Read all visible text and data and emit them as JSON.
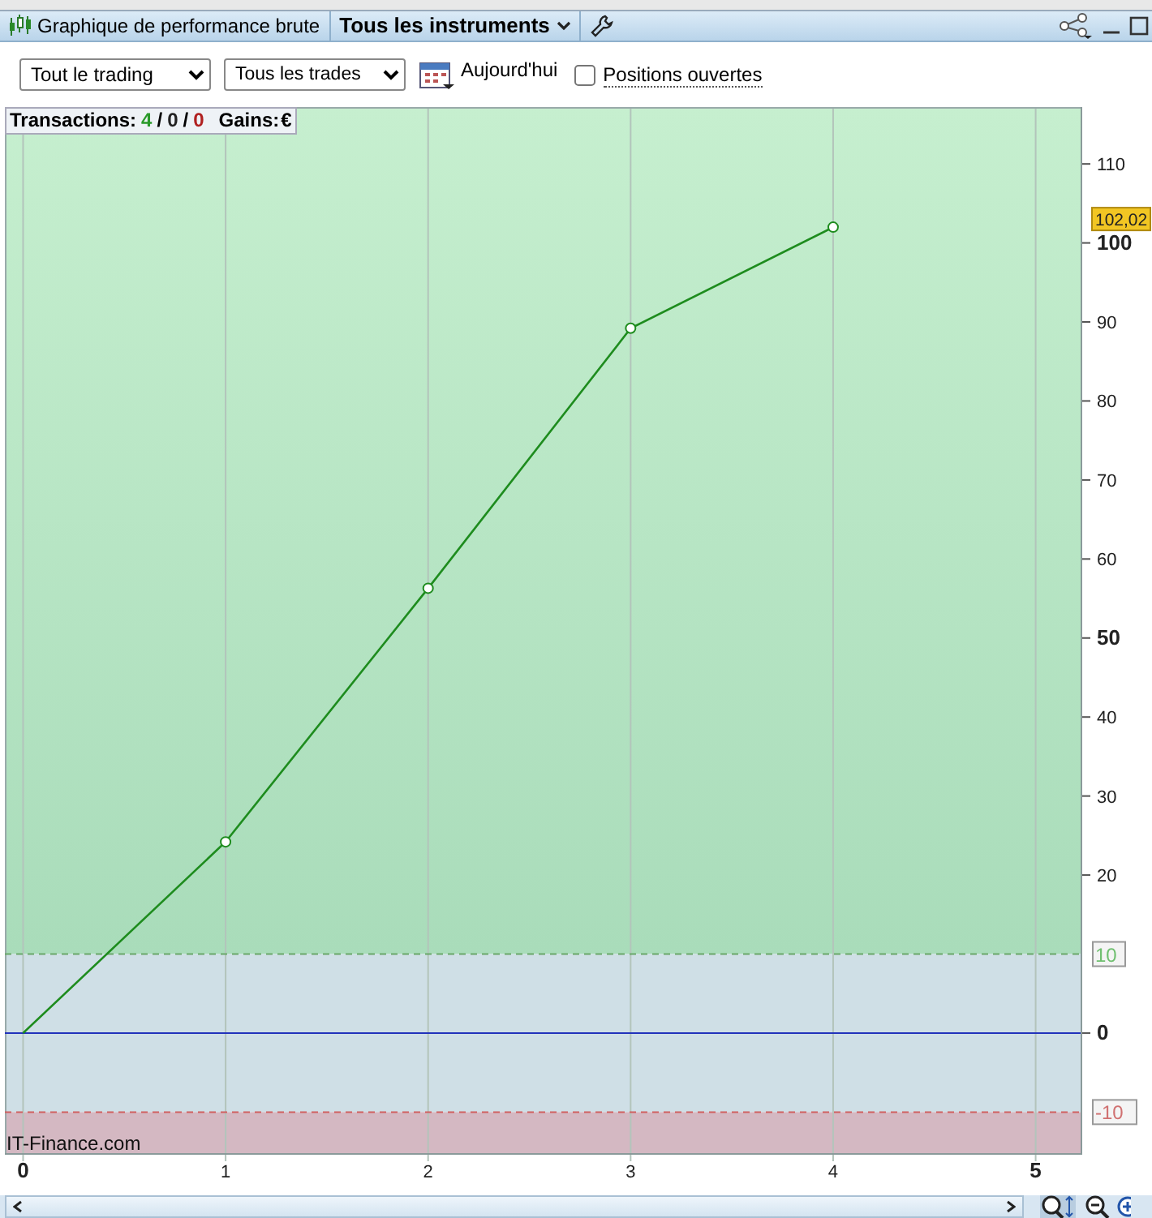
{
  "window": {
    "title": "Graphique de performance brute",
    "instrument_menu": "Tous les instruments"
  },
  "toolbar": {
    "scope_select": "Tout le trading",
    "trades_select": "Tous les trades",
    "date_label": "Aujourd'hui",
    "open_positions": {
      "label": "Positions ouvertes",
      "checked": false
    }
  },
  "summary": {
    "label": "Transactions:",
    "counts": [
      {
        "kind": "win",
        "value": "4"
      },
      {
        "kind": "neutral",
        "value": "0"
      },
      {
        "kind": "loss",
        "value": "0"
      }
    ],
    "separators": [
      "/",
      "/"
    ],
    "gains_label": "Gains:",
    "gains_value": "€"
  },
  "chart": {
    "credit": "IT-Finance.com",
    "last_value_tag": "102,02",
    "chart_data": {
      "type": "line",
      "x": [
        0,
        1,
        2,
        3,
        4
      ],
      "series": [
        {
          "color": "#1e8c1e",
          "marker": "o",
          "values": [
            0,
            24.2,
            56.3,
            89.2,
            102
          ]
        }
      ],
      "grid": true,
      "xlim": [
        -0.09,
        5.23
      ],
      "ylim": [
        -15.4,
        117.2
      ],
      "xticks": [
        0,
        1,
        2,
        3,
        4,
        5
      ],
      "yticks": [
        {
          "value": -10,
          "label": "-10"
        },
        0,
        {
          "value": 10,
          "label": "10"
        },
        20,
        30,
        40,
        50,
        60,
        70,
        80,
        90,
        100,
        110
      ]
    }
  }
}
